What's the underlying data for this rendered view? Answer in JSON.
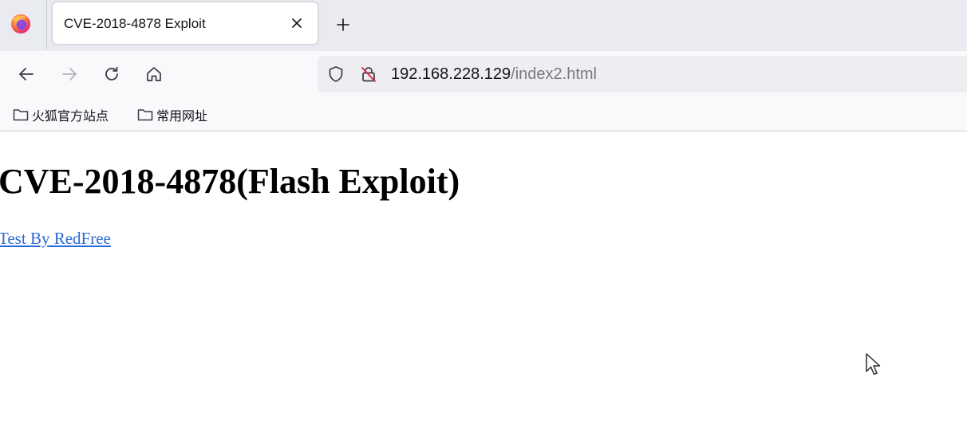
{
  "browser": {
    "tab": {
      "title": "CVE-2018-4878 Exploit",
      "close_glyph": "✕",
      "new_tab_glyph": "+"
    },
    "nav": {
      "back_icon": "arrow-left-icon",
      "forward_icon": "arrow-right-icon",
      "reload_icon": "reload-icon",
      "home_icon": "home-icon"
    },
    "urlbar": {
      "host": "192.168.228.129",
      "path": "/index2.html",
      "shield_icon": "shield-icon",
      "insecure_icon": "insecure-lock-icon"
    },
    "bookmarks": [
      {
        "label": "火狐官方站点",
        "icon": "folder-icon"
      },
      {
        "label": "常用网址",
        "icon": "folder-icon"
      }
    ]
  },
  "page": {
    "heading": "CVE-2018-4878(Flash Exploit)",
    "link": "Test By RedFree"
  },
  "colors": {
    "tabstrip_bg": "#e9ebf1",
    "toolbar_bg": "#f9f9fb",
    "urlbar_bg": "#eeeef2",
    "link": "#2a6ad8"
  }
}
